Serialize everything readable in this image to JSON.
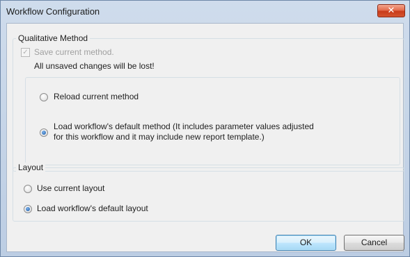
{
  "window": {
    "title": "Workflow Configuration",
    "close_symbol": "✕"
  },
  "qualitative": {
    "group_label": "Qualitative Method",
    "save_current_label": "Save current method.",
    "save_current_checked": true,
    "save_current_enabled": false,
    "warning_text": "All unsaved changes will be lost!",
    "reload_label": "Reload current method",
    "reload_selected": false,
    "load_default_label_line1": "Load workflow's default method (It includes parameter values adjusted",
    "load_default_label_line2": "for this workflow and it may include new report template.)",
    "load_default_selected": true
  },
  "layout": {
    "group_label": "Layout",
    "use_current_label": "Use current layout",
    "use_current_selected": false,
    "load_default_label": "Load workflow's default layout",
    "load_default_selected": true
  },
  "buttons": {
    "ok_label": "OK",
    "cancel_label": "Cancel"
  },
  "colors": {
    "title_bar": "#c4d4e8",
    "close_button": "#d4542f",
    "client_background": "#f0f0f0",
    "default_button_border": "#3c7fb1",
    "radio_selected": "#1a5aa6"
  }
}
